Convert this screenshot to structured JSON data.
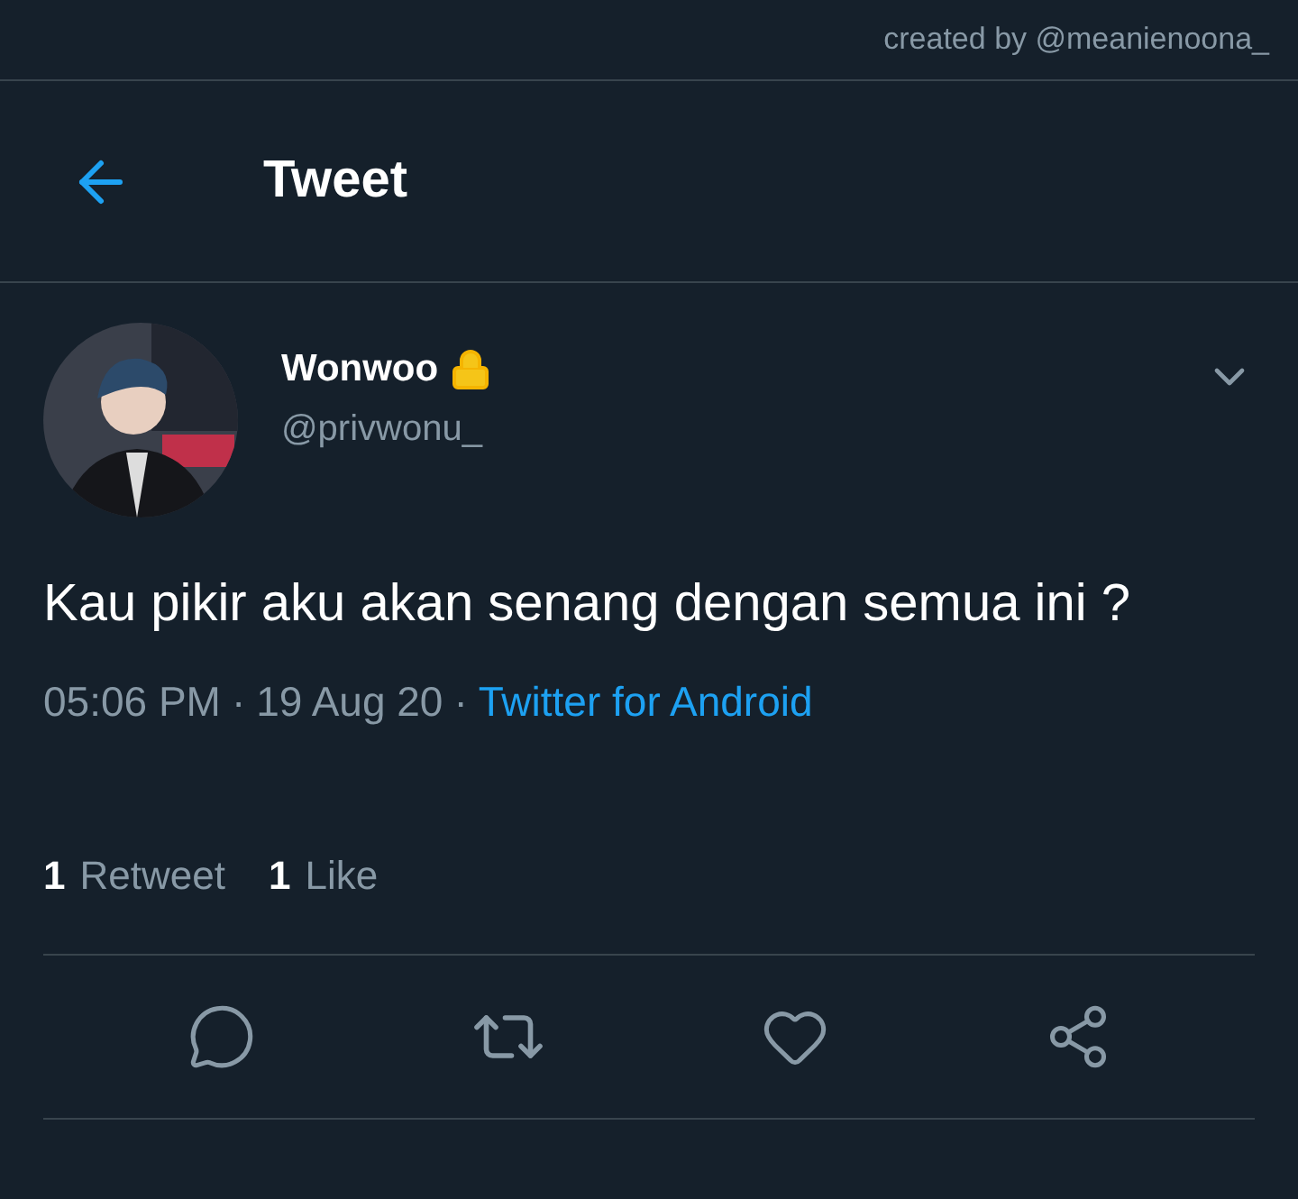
{
  "credit": "created by @meanienoona_",
  "header": {
    "title": "Tweet"
  },
  "tweet": {
    "name": "Wonwoo",
    "protected": true,
    "handle": "@privwonu_",
    "text": "Kau pikir aku akan senang dengan semua ini ?",
    "time": "05:06 PM",
    "separator": "·",
    "date": "19 Aug 20",
    "source": "Twitter for Android",
    "stats": [
      {
        "count": "1",
        "label": "Retweet"
      },
      {
        "count": "1",
        "label": "Like"
      }
    ]
  }
}
